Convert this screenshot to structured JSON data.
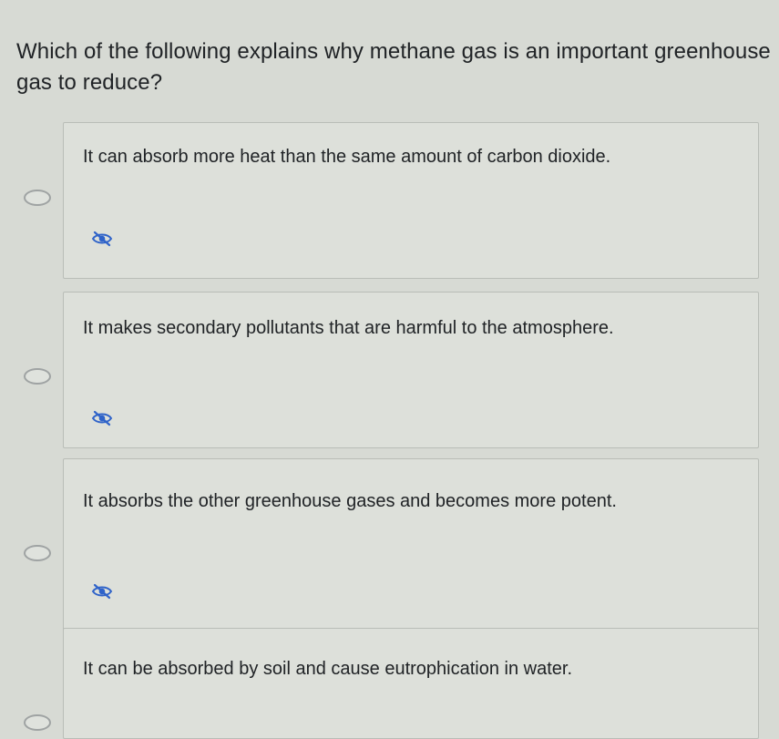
{
  "question": {
    "text": "Which of the following explains why methane gas is an important greenhouse gas to reduce?"
  },
  "options": [
    {
      "label": "It can absorb more heat than the same amount of carbon dioxide.",
      "selected": false,
      "icon": "eliminate-icon"
    },
    {
      "label": "It makes secondary pollutants that are harmful to the atmosphere.",
      "selected": false,
      "icon": "eliminate-icon"
    },
    {
      "label": "It absorbs the other greenhouse gases and becomes more potent.",
      "selected": false,
      "icon": "eliminate-icon"
    },
    {
      "label": "It can be absorbed by soil and cause eutrophication in water.",
      "selected": false,
      "icon": "eliminate-icon"
    }
  ],
  "colors": {
    "background": "#d7dad4",
    "card": "#dde0da",
    "card_border": "#b9bdb7",
    "icon": "#2f63c9",
    "text": "#202326"
  }
}
